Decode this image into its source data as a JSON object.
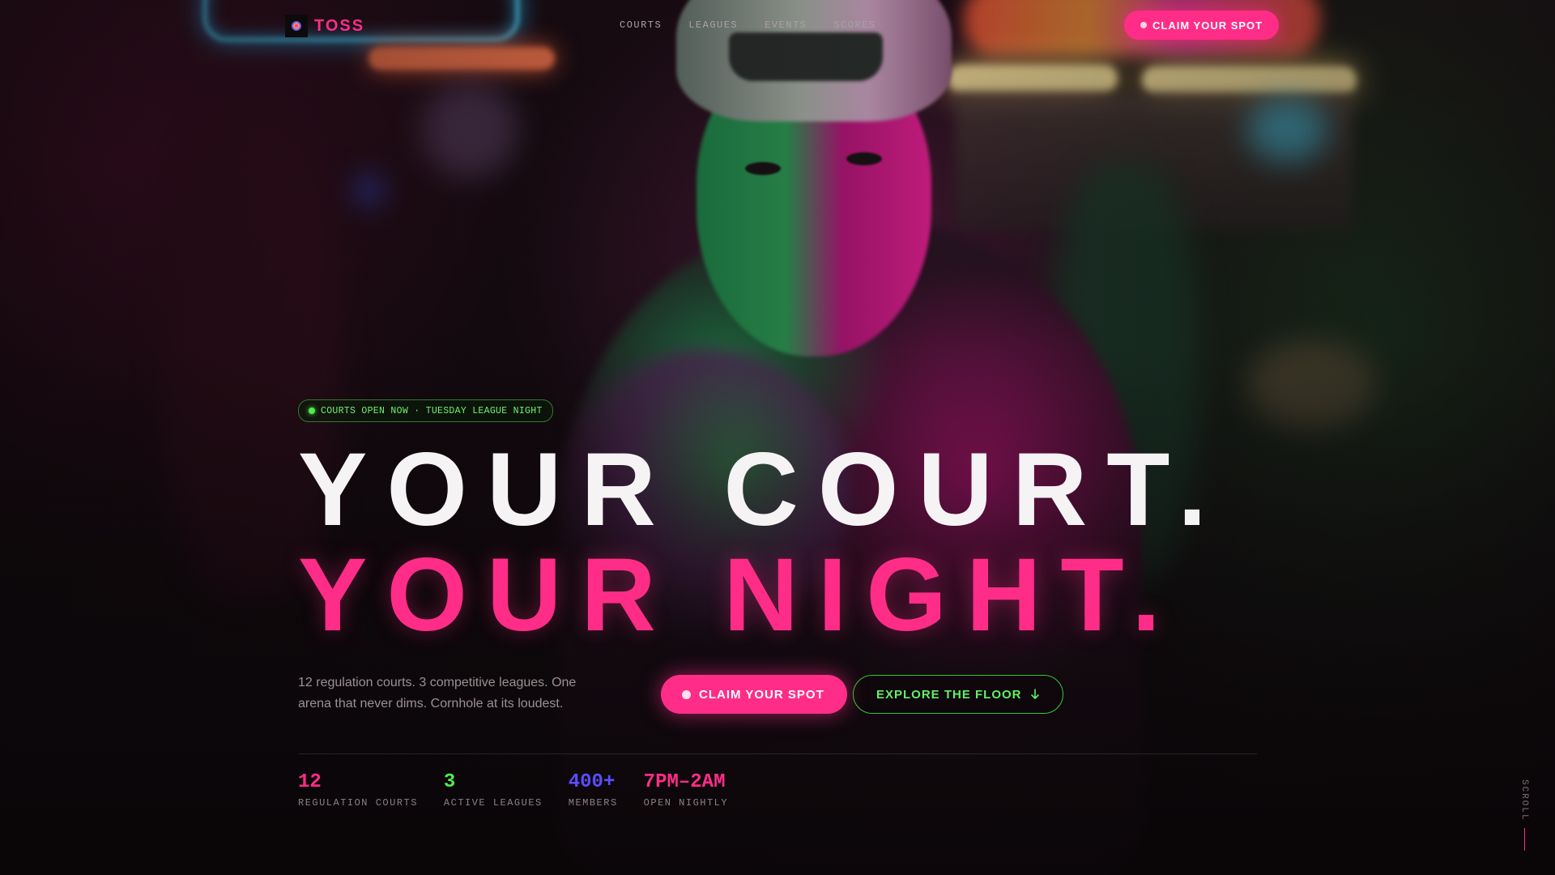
{
  "brand": {
    "name": "TOSS",
    "logo_icon": "toss-logo-icon"
  },
  "nav": {
    "links": [
      {
        "label": "COURTS"
      },
      {
        "label": "LEAGUES"
      },
      {
        "label": "EVENTS"
      },
      {
        "label": "SCORES"
      }
    ],
    "cta_label": "CLAIM YOUR SPOT"
  },
  "hero": {
    "status": "COURTS OPEN NOW · TUESDAY LEAGUE NIGHT",
    "headline_line1": "YOUR COURT.",
    "headline_line2": "YOUR NIGHT.",
    "subtext": "12 regulation courts. 3 competitive leagues. One arena that never dims. Cornhole at its loudest.",
    "primary_cta": "CLAIM YOUR SPOT",
    "secondary_cta": "EXPLORE THE FLOOR",
    "secondary_cta_icon": "arrow-down-icon"
  },
  "stats": [
    {
      "value": "12",
      "label": "REGULATION COURTS",
      "color": "#ff2d87"
    },
    {
      "value": "3",
      "label": "ACTIVE LEAGUES",
      "color": "#4ded4d"
    },
    {
      "value": "400+",
      "label": "MEMBERS",
      "color": "#5b4cff"
    },
    {
      "value": "7PM–2AM",
      "label": "OPEN NIGHTLY",
      "color": "#ff2d87"
    }
  ],
  "scroll_label": "SCROLL",
  "colors": {
    "accent_pink": "#ff2d87",
    "accent_green": "#4ded4d",
    "accent_violet": "#5b4cff"
  }
}
